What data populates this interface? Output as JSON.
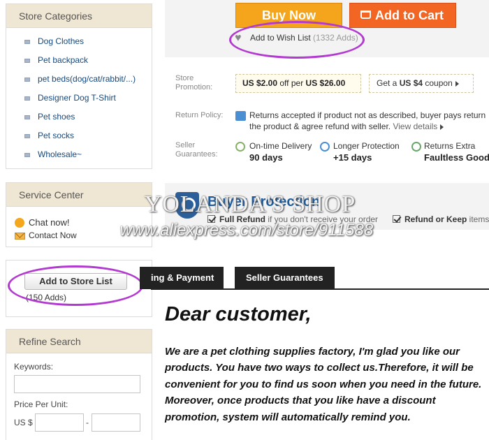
{
  "store_categories": {
    "title": "Store Categories",
    "items": [
      "Dog Clothes",
      "Pet backpack",
      "pet beds(dog/cat/rabbit/...)",
      "Designer Dog T-Shirt",
      "Pet shoes",
      "Pet socks",
      "Wholesale~"
    ]
  },
  "service_center": {
    "title": "Service Center",
    "chat_label": "Chat now!",
    "contact_label": "Contact Now"
  },
  "store_list": {
    "button_label": "Add to Store List",
    "adds": "(150 Adds)"
  },
  "refine_search": {
    "title": "Refine Search",
    "keywords_label": "Keywords:",
    "price_label": "Price Per Unit:",
    "currency_prefix": "US $",
    "range_separator": "-"
  },
  "buy": {
    "buy_now_label": "Buy Now",
    "add_to_cart_label": "Add to Cart",
    "wish_label": "Add to Wish List",
    "wish_count": "(1332 Adds)"
  },
  "promotion": {
    "label_line1": "Store",
    "label_line2": "Promotion:",
    "coupon1_amount": "US $2.00",
    "coupon1_mid": " off per ",
    "coupon1_threshold": "US $26.00",
    "coupon2_pre": "Get a ",
    "coupon2_value": "US $4",
    "coupon2_post": " coupon"
  },
  "return_policy": {
    "label": "Return Policy:",
    "line1": "Returns accepted if product not as described, buyer pays return",
    "line2": "the product & agree refund with seller.",
    "details_link": "View details"
  },
  "seller_guarantees": {
    "label_line1": "Seller",
    "label_line2": "Guarantees:",
    "items": [
      {
        "title": "On-time Delivery",
        "value": "90 days"
      },
      {
        "title": "Longer Protection",
        "value": "+15 days"
      },
      {
        "title": "Returns Extra",
        "value": "Faultless Goods"
      }
    ]
  },
  "buyer_protection": {
    "title": "Buyer Protection",
    "item1_bold": "Full Refund",
    "item1_rest": " if you don't receive your order",
    "item2_bold": "Refund or Keep",
    "item2_rest": " items"
  },
  "watermark": {
    "shop": "YOLANDA'S SHOP",
    "url": "www.aliexpress.com/store/911588"
  },
  "tabs": [
    "ing & Payment",
    "Seller Guarantees"
  ],
  "content": {
    "heading": "Dear customer,",
    "paragraph": "We are a pet clothing supplies factory, I'm glad you like our products. You have two ways to collect us.Therefore, it will be convenient for you to find us soon when you need in the future. Moreover, once products that you like have a discount promotion, system will automatically remind you."
  },
  "colors": {
    "accent_purple": "#b33ad0",
    "buy_orange": "#f4a51c",
    "cart_orange": "#f26522",
    "protection_blue": "#1f5b9b",
    "panel_header": "#efe6d4"
  }
}
